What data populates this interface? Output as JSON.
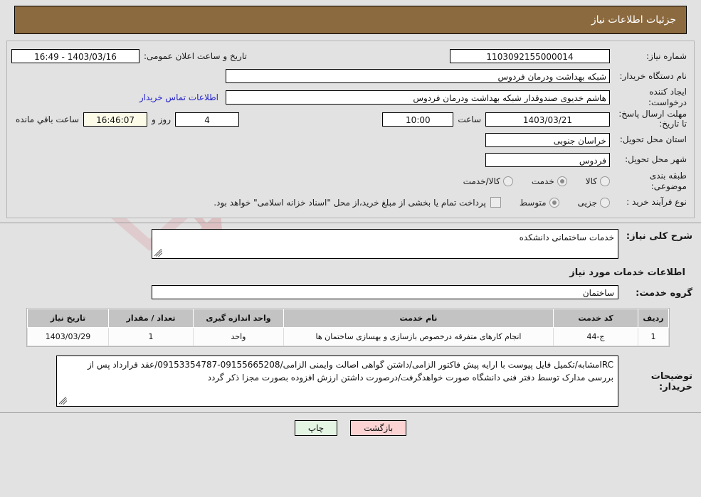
{
  "header": {
    "title": "جزئیات اطلاعات نیاز"
  },
  "form": {
    "labels": {
      "need_no": "شماره نیاز:",
      "buyer_org": "نام دستگاه خریدار:",
      "requester": "ایجاد کننده درخواست:",
      "deadline": "مهلت ارسال پاسخ: تا تاریخ:",
      "province": "استان محل تحویل:",
      "city": "شهر محل تحویل:",
      "category": "طبقه بندی موضوعی:",
      "process_type": "نوع فرآیند خرید :",
      "public_announce": "تاریخ و ساعت اعلان عمومی:",
      "hour_word": "ساعت",
      "day_and": "روز و",
      "remaining_word": "ساعت باقي مانده",
      "contact_link": "اطلاعات تماس خریدار"
    },
    "values": {
      "need_no": "1103092155000014",
      "buyer_org": "شبکه بهداشت ودرمان فردوس",
      "requester": "هاشم خدیوی صندوقدار شبکه بهداشت ودرمان فردوس",
      "deadline_date": "1403/03/21",
      "deadline_time": "10:00",
      "remaining_days": "4",
      "remaining_time": "16:46:07",
      "province": "خراسان جنوبی",
      "city": "فردوس",
      "public_announce": "1403/03/16 - 16:49"
    },
    "category_options": [
      {
        "label": "کالا",
        "selected": false
      },
      {
        "label": "خدمت",
        "selected": true
      },
      {
        "label": "کالا/خدمت",
        "selected": false
      }
    ],
    "process_options": [
      {
        "label": "جزیی",
        "selected": false
      },
      {
        "label": "متوسط",
        "selected": true
      }
    ],
    "treasury_note": "پرداخت تمام یا بخشی از مبلغ خرید،از محل \"اسناد خزانه اسلامی\" خواهد بود.",
    "treasury_checked": false
  },
  "description": {
    "label": "شرح کلی نیاز:",
    "value": "خدمات ساختمانی دانشکده"
  },
  "services_section": {
    "title": "اطلاعات خدمات مورد نیاز",
    "group_label": "گروه خدمت:",
    "group_value": "ساختمان"
  },
  "items_table": {
    "columns": [
      "ردیف",
      "کد خدمت",
      "نام خدمت",
      "واحد اندازه گیری",
      "تعداد / مقدار",
      "تاریخ نیاز"
    ],
    "rows": [
      {
        "radif": "1",
        "code": "ج-44",
        "name": "انجام کارهای متفرقه درخصوص بازسازی و بهسازی ساختمان ها",
        "unit": "واحد",
        "qty": "1",
        "date": "1403/03/29"
      }
    ]
  },
  "notes": {
    "label": "توضیحات خریدار:",
    "value": "IRCمشابه/تکمیل فایل پیوست با ارایه پیش فاکتور الزامی/داشتن گواهی اصالت وایمنی الزامی/09155665208-09153354787/عقد قرارداد پس از بررسی مدارک توسط دفتر فنی دانشگاه صورت خواهدگرفت/درصورت داشتن ارزش افزوده بصورت مجزا ذکر گردد"
  },
  "footer": {
    "back_label": "بازگشت",
    "print_label": "چاپ"
  },
  "watermark": {
    "text": "AriaTender.net"
  },
  "colors": {
    "header_bg": "#8c6a3f",
    "page_bg": "#e2e2e2",
    "link": "#2222cc",
    "table_header_bg": "#c3c3c3",
    "back_btn_bg": "#fbd3d3",
    "print_btn_bg": "#e4f5e4",
    "remaining_bg": "#fbfbe8"
  }
}
